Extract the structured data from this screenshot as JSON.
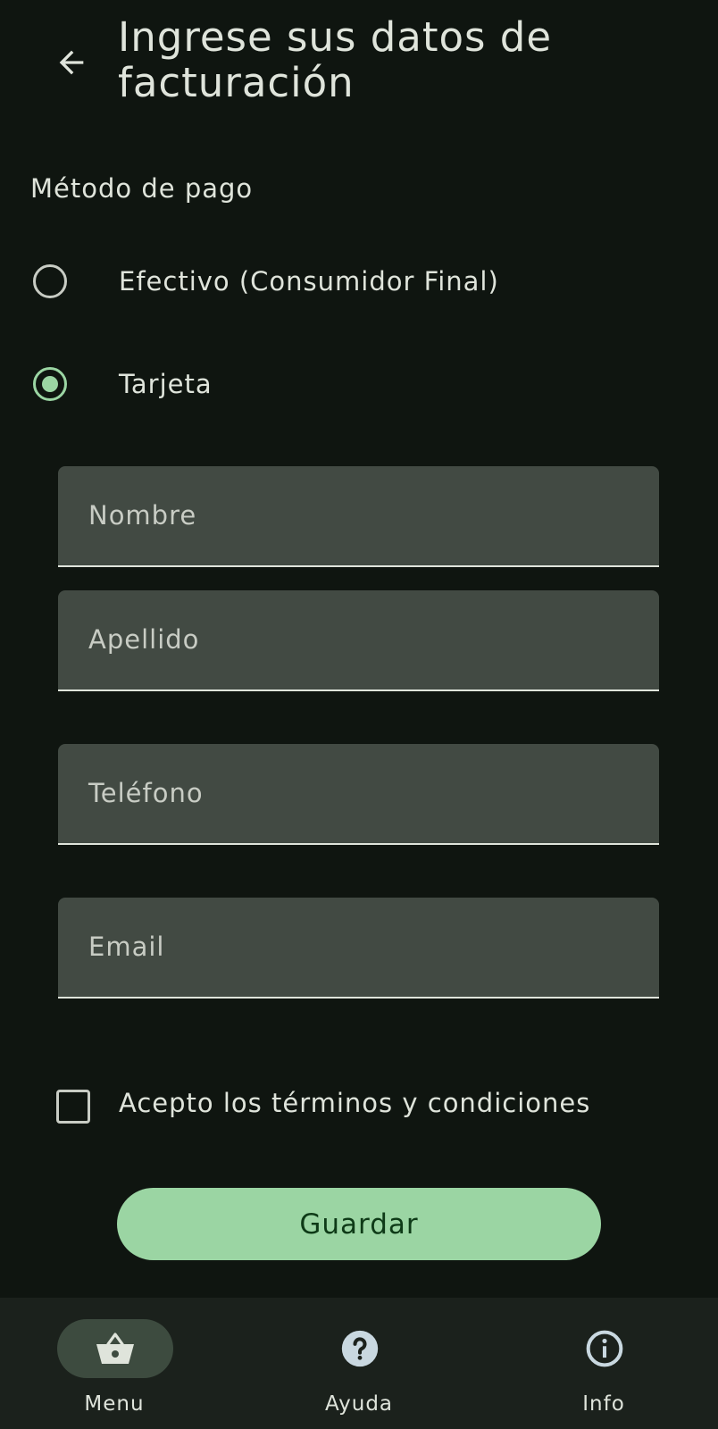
{
  "header": {
    "back_icon": "arrow-back-icon",
    "title": "Ingrese sus datos de facturación"
  },
  "payment": {
    "section_label": "Método de pago",
    "options": [
      {
        "label": "Efectivo (Consumidor Final)",
        "selected": false
      },
      {
        "label": "Tarjeta",
        "selected": true
      }
    ]
  },
  "form": {
    "fields": [
      {
        "label": "Nombre",
        "value": ""
      },
      {
        "label": "Apellido",
        "value": ""
      },
      {
        "label": "Teléfono",
        "value": ""
      },
      {
        "label": "Email",
        "value": ""
      }
    ],
    "terms_label": "Acepto los términos y condiciones",
    "terms_checked": false,
    "save_label": "Guardar"
  },
  "nav": {
    "items": [
      {
        "label": "Menu",
        "icon": "basket-icon",
        "active": true
      },
      {
        "label": "Ayuda",
        "icon": "help-icon",
        "active": false
      },
      {
        "label": "Info",
        "icon": "info-icon",
        "active": false
      }
    ]
  },
  "colors": {
    "background": "#0f1510",
    "accent": "#9bd5a3",
    "field_fill": "#424a43",
    "nav_background": "#1b211c",
    "active_pill": "#3d4b3f",
    "text": "#dfe4db"
  }
}
